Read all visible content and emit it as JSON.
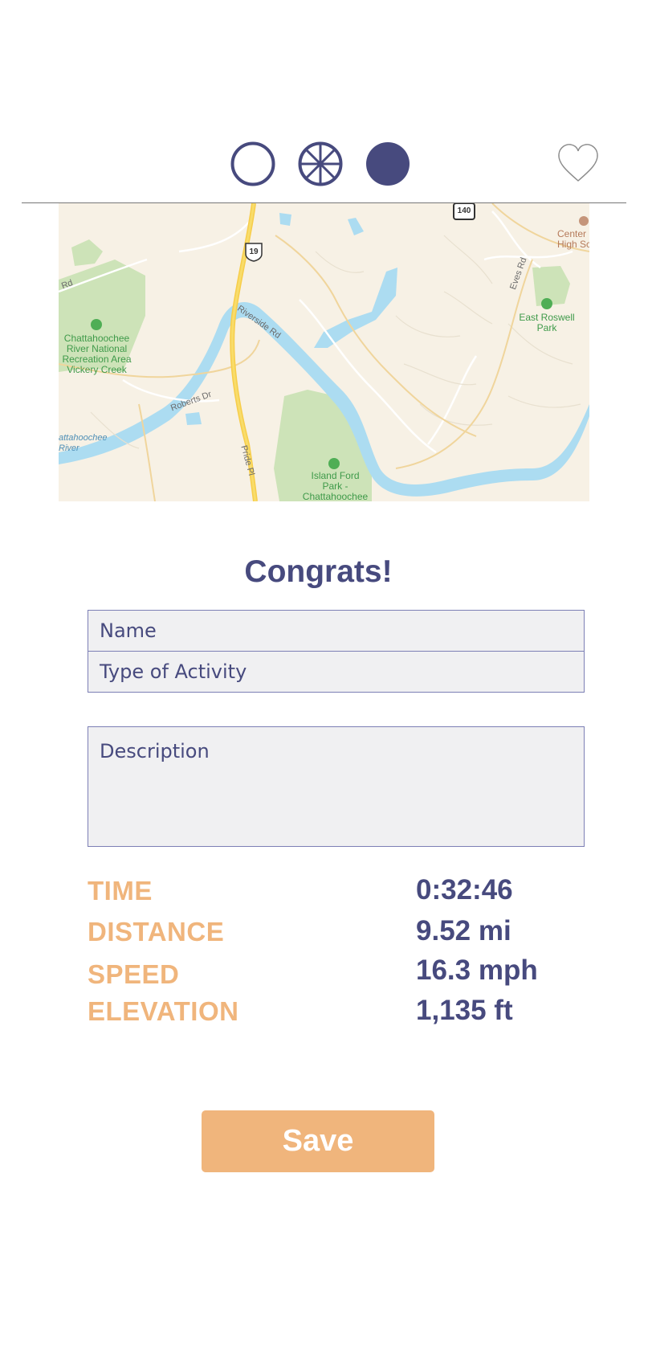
{
  "header": {
    "modes": [
      {
        "icon": "circle-outline-icon",
        "selected": false
      },
      {
        "icon": "wheel-icon",
        "selected": false
      },
      {
        "icon": "circle-filled-icon",
        "selected": true
      }
    ],
    "favorite_icon": "heart-outline-icon",
    "accent_color": "#474a7e"
  },
  "map": {
    "labels": {
      "chattahoochee_park": "Chattahoochee\nRiver National\nRecreation Area\nVickery Creek",
      "east_roswell_park": "East Roswell\nPark",
      "island_ford_park": "Island Ford\nPark -\nChattahoochee",
      "river": "attahoochee\nRiver",
      "riverside_rd": "Riverside Rd",
      "roberts_dr": "Roberts Dr",
      "pride_pl": "Pride Pl",
      "eves_rd": "Eves Rd",
      "rd": "Rd",
      "center_high": "Center\nHigh Sc",
      "us19": "19",
      "route140": "140"
    }
  },
  "title": "Congrats!",
  "form": {
    "name_placeholder": "Name",
    "activity_placeholder": "Type of Activity",
    "description_placeholder": "Description"
  },
  "stats": [
    {
      "label": "TIME",
      "value": "0:32:46"
    },
    {
      "label": "DISTANCE",
      "value": "9.52 mi"
    },
    {
      "label": "SPEED",
      "value": "16.3 mph"
    },
    {
      "label": "ELEVATION",
      "value": "1,135 ft"
    }
  ],
  "save_label": "Save",
  "colors": {
    "primary": "#474a7e",
    "accent": "#f0b57c",
    "field_bg": "#f0f0f2"
  }
}
